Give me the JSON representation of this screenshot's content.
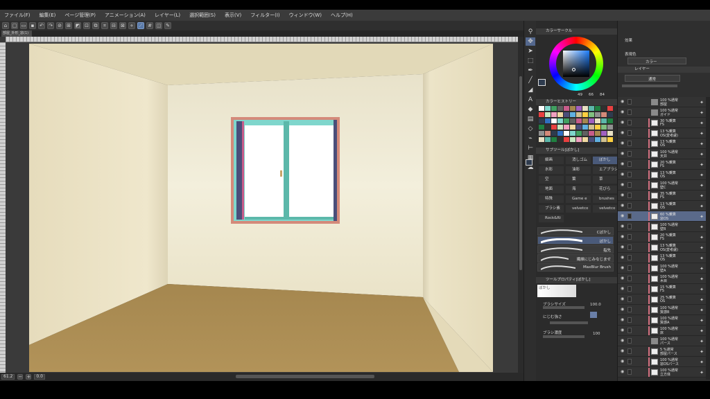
{
  "menu": [
    "ファイル(F)",
    "編集(E)",
    "ページ管理(P)",
    "アニメーション(A)",
    "レイヤー(L)",
    "選択範囲(S)",
    "表示(V)",
    "フィルター(I)",
    "ウィンドウ(W)",
    "ヘルプ(H)"
  ],
  "document": {
    "tab_label": "部屋_外形_窓(1)"
  },
  "status": {
    "zoom": "61.2",
    "angle": "0.0"
  },
  "panels": {
    "color_circle": "カラーサークル",
    "color_history": "カラーヒストリー",
    "subtool": "サブツール[ぼかし]",
    "tool_property": "ツールプロパティ[ぼかし]",
    "effects": "効果",
    "expression_color": "表現色",
    "expression_value": "カラー",
    "layer_tab": "レイヤー",
    "blend_mode": "通常"
  },
  "color": {
    "h": "49",
    "s": "66",
    "v": "84",
    "main": "#2e3b4e"
  },
  "subtool_groups": [
    [
      "細画",
      "消しゴム",
      "ぼかし"
    ],
    [
      "水彩",
      "油彩",
      "エアブラシ"
    ],
    [
      "空",
      "葉",
      "草"
    ],
    [
      "地面",
      "海",
      "花びら"
    ],
    [
      "特殊",
      "Game e",
      "brushes"
    ],
    [
      "ブラシ素",
      "velvetco",
      "velvetco"
    ],
    [
      "Rock&Ri",
      "",
      ""
    ]
  ],
  "brushes": [
    "Cぼかし",
    "ぼかし",
    "指先",
    "繊維にじみなじませ",
    "MaxBlur Brush"
  ],
  "tool_property": {
    "preview_label": "ぼかし",
    "brush_size_label": "ブラシサイズ",
    "brush_size_value": "100.0",
    "blur_label": "にじむ強さ",
    "density_label": "ブラシ濃度",
    "density_value": "100"
  },
  "layers": [
    {
      "l1": "100 %通常",
      "l2": "部屋",
      "type": "folder"
    },
    {
      "l1": "100 %通常",
      "l2": "ガイド",
      "type": "folder"
    },
    {
      "l1": "30 %乗算",
      "l2": "FS"
    },
    {
      "l1": "13 %乗算",
      "l2": "OS(変考慮)"
    },
    {
      "l1": "13 %乗算",
      "l2": "OS"
    },
    {
      "l1": "100 %通常",
      "l2": "天井"
    },
    {
      "l1": "20 %乗算",
      "l2": "FS"
    },
    {
      "l1": "13 %乗算",
      "l2": "OS"
    },
    {
      "l1": "100 %通常",
      "l2": "壁C"
    },
    {
      "l1": "35 %乗算",
      "l2": "FS"
    },
    {
      "l1": "13 %乗算",
      "l2": "OS"
    },
    {
      "l1": "60 %乗算",
      "l2": "窓OS",
      "selected": true
    },
    {
      "l1": "100 %通常",
      "l2": "壁B"
    },
    {
      "l1": "20 %乗算",
      "l2": "FS"
    },
    {
      "l1": "13 %乗算",
      "l2": "OS(変考慮)"
    },
    {
      "l1": "13 %乗算",
      "l2": "OS"
    },
    {
      "l1": "100 %通常",
      "l2": "壁A"
    },
    {
      "l1": "100 %通常",
      "l2": "木目"
    },
    {
      "l1": "15 %乗算",
      "l2": "FS"
    },
    {
      "l1": "25 %乗算",
      "l2": "OS"
    },
    {
      "l1": "100 %通常",
      "l2": "質感B"
    },
    {
      "l1": "100 %通常",
      "l2": "質感A"
    },
    {
      "l1": "100 %通常",
      "l2": "床"
    },
    {
      "l1": "100 %通常",
      "l2": "パース",
      "type": "folder"
    },
    {
      "l1": "5 %通常",
      "l2": "部屋パース"
    },
    {
      "l1": "100 %通常",
      "l2": "窓OSパース"
    },
    {
      "l1": "100 %通常",
      "l2": "立方体"
    }
  ]
}
